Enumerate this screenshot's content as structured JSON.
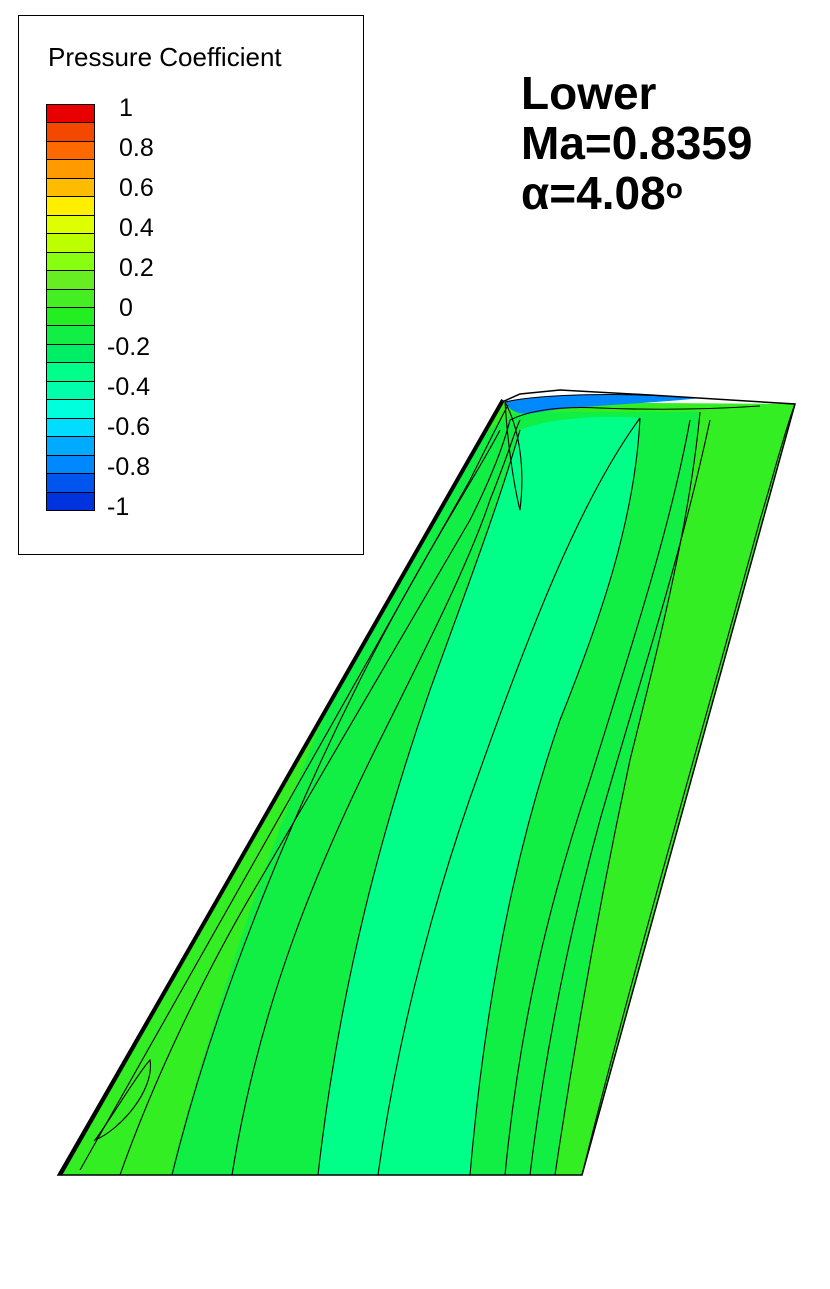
{
  "legend": {
    "title": "Pressure Coefficient",
    "ticks": [
      "1",
      "0.8",
      "0.6",
      "0.4",
      "0.2",
      "0",
      "-0.2",
      "-0.4",
      "-0.6",
      "-0.8",
      "-1"
    ],
    "band_colors": [
      "#e80000",
      "#f44800",
      "#ff6a00",
      "#ff9a00",
      "#ffbb00",
      "#ffee00",
      "#ddff00",
      "#bbff00",
      "#88ff11",
      "#66ee22",
      "#44ee22",
      "#22ee22",
      "#11ee44",
      "#00ee66",
      "#00ff88",
      "#00ffaa",
      "#00ffdd",
      "#00ddff",
      "#00aaff",
      "#0088ff",
      "#0055ee",
      "#0033dd"
    ]
  },
  "annotation": {
    "surface": "Lower",
    "mach": "Ma=0.8359",
    "alpha_symbol": "α",
    "alpha_value": "=4.08",
    "alpha_degree": "o"
  },
  "colors": {
    "surface_inner": "#00ff88",
    "surface_mid": "#11ee44",
    "surface_outer": "#33ee22",
    "trailing_edge": "#55ff11",
    "tip_blue": "#0088ff",
    "contour_line": "#000000"
  }
}
